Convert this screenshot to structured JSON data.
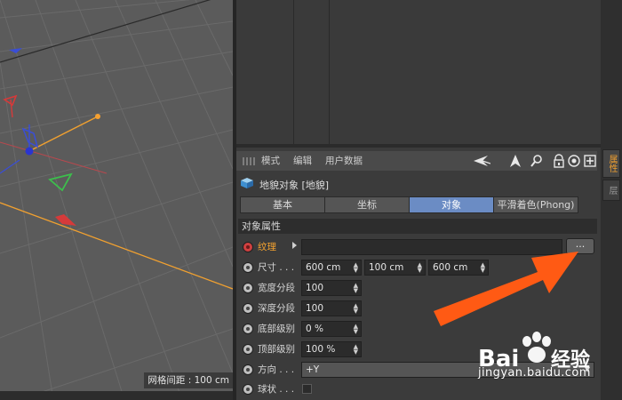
{
  "viewport": {
    "grid_spacing_text": "网格间距 : 100 cm",
    "axis_colors": {
      "x": "#d63a3a",
      "y": "#3cbf4c",
      "z": "#3a4ed6",
      "handle": "#f5a030"
    }
  },
  "attribute_manager": {
    "menu": [
      "模式",
      "编辑",
      "用户数据"
    ],
    "toolbar_icons": [
      "arrow-left-icon",
      "arrow-up-icon",
      "search-icon",
      "lock-icon",
      "target-icon",
      "new-panel-icon"
    ],
    "object_title": "地貌对象 [地貌]",
    "tabs": [
      "基本",
      "坐标",
      "对象",
      "平滑着色(Phong)"
    ],
    "active_tab": "对象",
    "active_color": "#6b8cc4",
    "section_title": "对象属性",
    "properties": {
      "texture_label": "纹理",
      "texture_button": "...",
      "size_label": "尺寸 . . .",
      "size_values": [
        "600 cm",
        "100 cm",
        "600 cm"
      ],
      "width_seg_label": "宽度分段",
      "width_seg_value": "100",
      "depth_seg_label": "深度分段",
      "depth_seg_value": "100",
      "bottom_level_label": "底部级别",
      "bottom_level_value": "0 %",
      "top_level_label": "顶部级别",
      "top_level_value": "100 %",
      "direction_label": "方向 . . .",
      "direction_value": "+Y",
      "sphere_label": "球状 . . ."
    }
  },
  "side_panel": {
    "tabs": [
      "属性",
      "层"
    ]
  },
  "watermark": {
    "logo_text": "Bai",
    "logo_text2": "经验",
    "url": "jingyan.baidu.com"
  },
  "annotation": {
    "arrow_color": "#ff5a14"
  }
}
